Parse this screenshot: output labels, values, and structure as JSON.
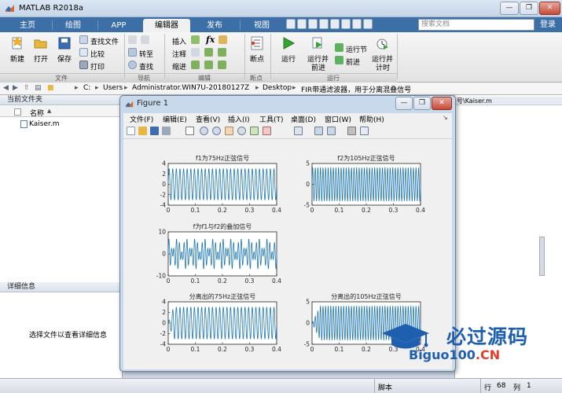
{
  "app": {
    "title": "MATLAB R2018a",
    "login": "登录",
    "search_placeholder": "搜索文档",
    "win_buttons": [
      "—",
      "❐",
      "✕"
    ]
  },
  "tabs": [
    "主页",
    "绘图",
    "APP",
    "编辑器",
    "发布",
    "视图"
  ],
  "active_tab": "编辑器",
  "ribbon": {
    "file": {
      "group": "文件",
      "new": "新建",
      "open": "打开",
      "save": "保存",
      "find_files": "查找文件",
      "compare": "比较",
      "print": "打印"
    },
    "nav": {
      "group": "导航",
      "goto": "转至",
      "find": "查找"
    },
    "edit": {
      "group": "编辑",
      "insert": "插入",
      "comment": "注释",
      "indent": "缩进",
      "fx": "fx"
    },
    "breakpoints": {
      "group": "断点",
      "label": "断点"
    },
    "run": {
      "group": "运行",
      "run": "运行",
      "run_advance_1": "运行并",
      "run_advance_2": "前进",
      "run_section": "运行节",
      "advance": "前进",
      "run_time_1": "运行并",
      "run_time_2": "计时"
    }
  },
  "address": {
    "segments": [
      "C:",
      "Users",
      "Administrator.WIN7U-20180127Z",
      "Desktop",
      "FIR带通滤波器，用于分离混叠信号"
    ],
    "separator": "▸"
  },
  "current_folder": {
    "title": "当前文件夹",
    "col_name": "名称",
    "col_sort": "▲",
    "files": [
      "Kaiser.m"
    ]
  },
  "details": {
    "title": "详细信息",
    "message": "选择文件以查看详细信息"
  },
  "editor_tab": "号\\Kaiser.m",
  "status": {
    "mode": "脚本",
    "row_label": "行",
    "row": "68",
    "col_label": "列",
    "col": "1"
  },
  "figure": {
    "title": "Figure 1",
    "menu": [
      "文件(F)",
      "编辑(E)",
      "查看(V)",
      "插入(I)",
      "工具(T)",
      "桌面(D)",
      "窗口(W)",
      "帮助(H)"
    ]
  },
  "chart_data": [
    {
      "type": "line",
      "title": "f1为75Hz正弦信号",
      "xlim": [
        0,
        0.4
      ],
      "ylim": [
        -4,
        4
      ],
      "xticks": [
        0,
        0.1,
        0.2,
        0.3,
        0.4
      ],
      "yticks": [
        -4,
        -2,
        0,
        2,
        4
      ],
      "series": [
        {
          "frequency_hz": 75,
          "amplitude": 3,
          "color": "#1f77b4"
        }
      ]
    },
    {
      "type": "line",
      "title": "f2为105Hz正弦信号",
      "xlim": [
        0,
        0.4
      ],
      "ylim": [
        -5,
        5
      ],
      "xticks": [
        0,
        0.1,
        0.2,
        0.3,
        0.4
      ],
      "yticks": [
        -5,
        0,
        5
      ],
      "series": [
        {
          "frequency_hz": 105,
          "amplitude": 4,
          "color": "#1f77b4"
        }
      ]
    },
    {
      "type": "line",
      "title": "f为f1与f2的叠加信号",
      "xlim": [
        0,
        0.4
      ],
      "ylim": [
        -10,
        10
      ],
      "xticks": [
        0,
        0.1,
        0.2,
        0.3,
        0.4
      ],
      "yticks": [
        -10,
        0,
        10
      ],
      "series": [
        {
          "components_hz": [
            75,
            105
          ],
          "amplitudes": [
            3,
            4
          ],
          "color": "#1f77b4"
        }
      ]
    },
    {
      "type": "line",
      "title": "分离出的75Hz正弦信号",
      "xlim": [
        0,
        0.4
      ],
      "ylim": [
        -4,
        4
      ],
      "xticks": [
        0,
        0.1,
        0.2,
        0.3,
        0.4
      ],
      "yticks": [
        -4,
        -2,
        0,
        2,
        4
      ],
      "series": [
        {
          "frequency_hz": 75,
          "amplitude": 3,
          "ramp_up_end_s": 0.02,
          "color": "#1f77b4"
        }
      ]
    },
    {
      "type": "line",
      "title": "分离出的105Hz正弦信号",
      "xlim": [
        0,
        0.4
      ],
      "ylim": [
        -5,
        5
      ],
      "xticks": [
        0,
        0.1,
        0.2,
        0.3,
        0.4
      ],
      "yticks": [
        -5,
        0,
        5
      ],
      "series": [
        {
          "frequency_hz": 105,
          "amplitude": 4,
          "ramp_up_end_s": 0.03,
          "color": "#1f77b4"
        }
      ]
    }
  ],
  "watermark": {
    "brand": "必过源码",
    "domain_main": "Biguo100",
    "domain_tld": ".CN"
  },
  "colors": {
    "tab_bar": "#3b6fa6",
    "plot_line": "#1f77b4",
    "watermark_blue": "#1f5fb0",
    "watermark_red": "#e43d2b"
  }
}
